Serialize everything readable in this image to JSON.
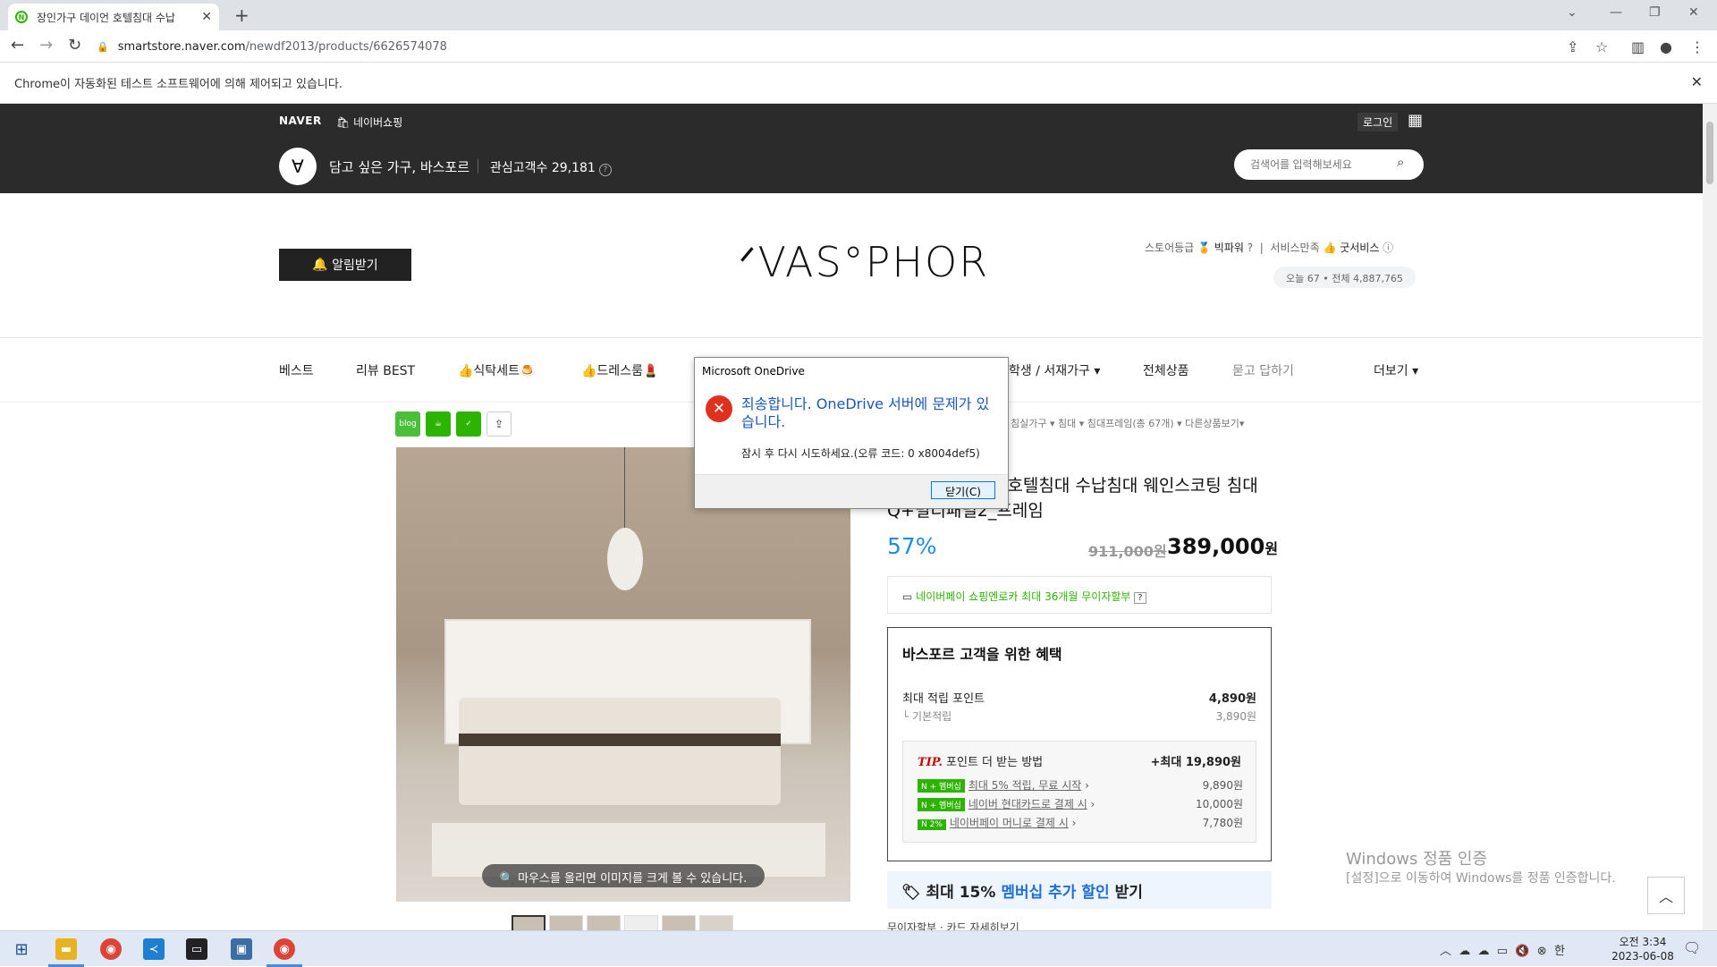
{
  "browser": {
    "tab_title": "장인가구 데이언 호텔침대 수납",
    "url_host": "smartstore.naver.com",
    "url_path": "/newdf2013/products/6626574078",
    "infobar": "Chrome이 자동화된 테스트 소프트웨어에 의해 제어되고 있습니다."
  },
  "topbar": {
    "naver": "NAVER",
    "shopping": "네이버쇼핑",
    "login": "로그인"
  },
  "store": {
    "name": "담고 싶은 가구, 바스포르",
    "fans": "관심고객수 29,181",
    "search_placeholder": "검색어를 입력해보세요",
    "alarm": "알림받기",
    "brand_logo": "ᐟVAS°PHOR",
    "grade_label": "스토어등급",
    "grade_value": "빅파워",
    "service_label": "서비스만족",
    "service_value": "굿서비스",
    "visits": "오늘 67 • 전체 4,887,765"
  },
  "categories": [
    "베스트",
    "리뷰 BEST",
    "👍식탁세트🍮",
    "👍드레스룸💄",
    "학생 / 서재가구",
    "전체상품",
    "묻고 답하기",
    "더보기"
  ],
  "breadcrumb": "침실가구 ▾   침대 ▾   침대프레임(총 67개) ▾   다른상품보기▾",
  "product": {
    "title": "장인가구 데이언 호텔침대 수납침대 웨인스코팅 침대 Q+멀티패널2_프레임",
    "discount": "57%",
    "original_price": "911,000원",
    "price": "389,000",
    "price_unit": "원",
    "image_hint": "마우스를 올리면 이미지를 크게 볼 수 있습니다.",
    "pay_line": "네이버페이 쇼핑엔로카 최대 36개월 무이자할부"
  },
  "benefit": {
    "heading": "바스포르 고객을 위한 혜택",
    "max_point_label": "최대 적립 포인트",
    "max_point_value": "4,890원",
    "base_label": "기본적립",
    "base_value": "3,890원",
    "tip_label": "포인트 더 받는 방법",
    "tip_prefix": "TIP.",
    "tip_value": "+최대 19,890원",
    "tips": [
      {
        "badge": "N + 멤버십",
        "text": "최대 5% 적립, 무료 시작",
        "value": "9,890원"
      },
      {
        "badge": "N + 멤버십",
        "text": "네이버 현대카드로 결제 시",
        "value": "10,000원"
      },
      {
        "badge": "N 2%",
        "text": "네이버페이 머니로 결제 시",
        "value": "7,780원"
      }
    ],
    "membership_banner_pre": "최대 15% ",
    "membership_banner_hl": "멤버십 추가 할인",
    "membership_banner_post": " 받기",
    "fineprint": "무이자할부 · 카드 자세히보기"
  },
  "watermark": {
    "line1": "Windows 정품 인증",
    "line2": "[설정]으로 이동하여 Windows를 정품 인증합니다."
  },
  "dialog": {
    "title": "Microsoft OneDrive",
    "message": "죄송합니다. OneDrive 서버에 문제가 있습니다.",
    "detail": "잠시 후 다시 시도하세요.(오류 코드: 0 x8004def5)",
    "button": "닫기(C)"
  },
  "taskbar": {
    "time": "오전 3:34",
    "date": "2023-06-08",
    "ime": "한"
  }
}
